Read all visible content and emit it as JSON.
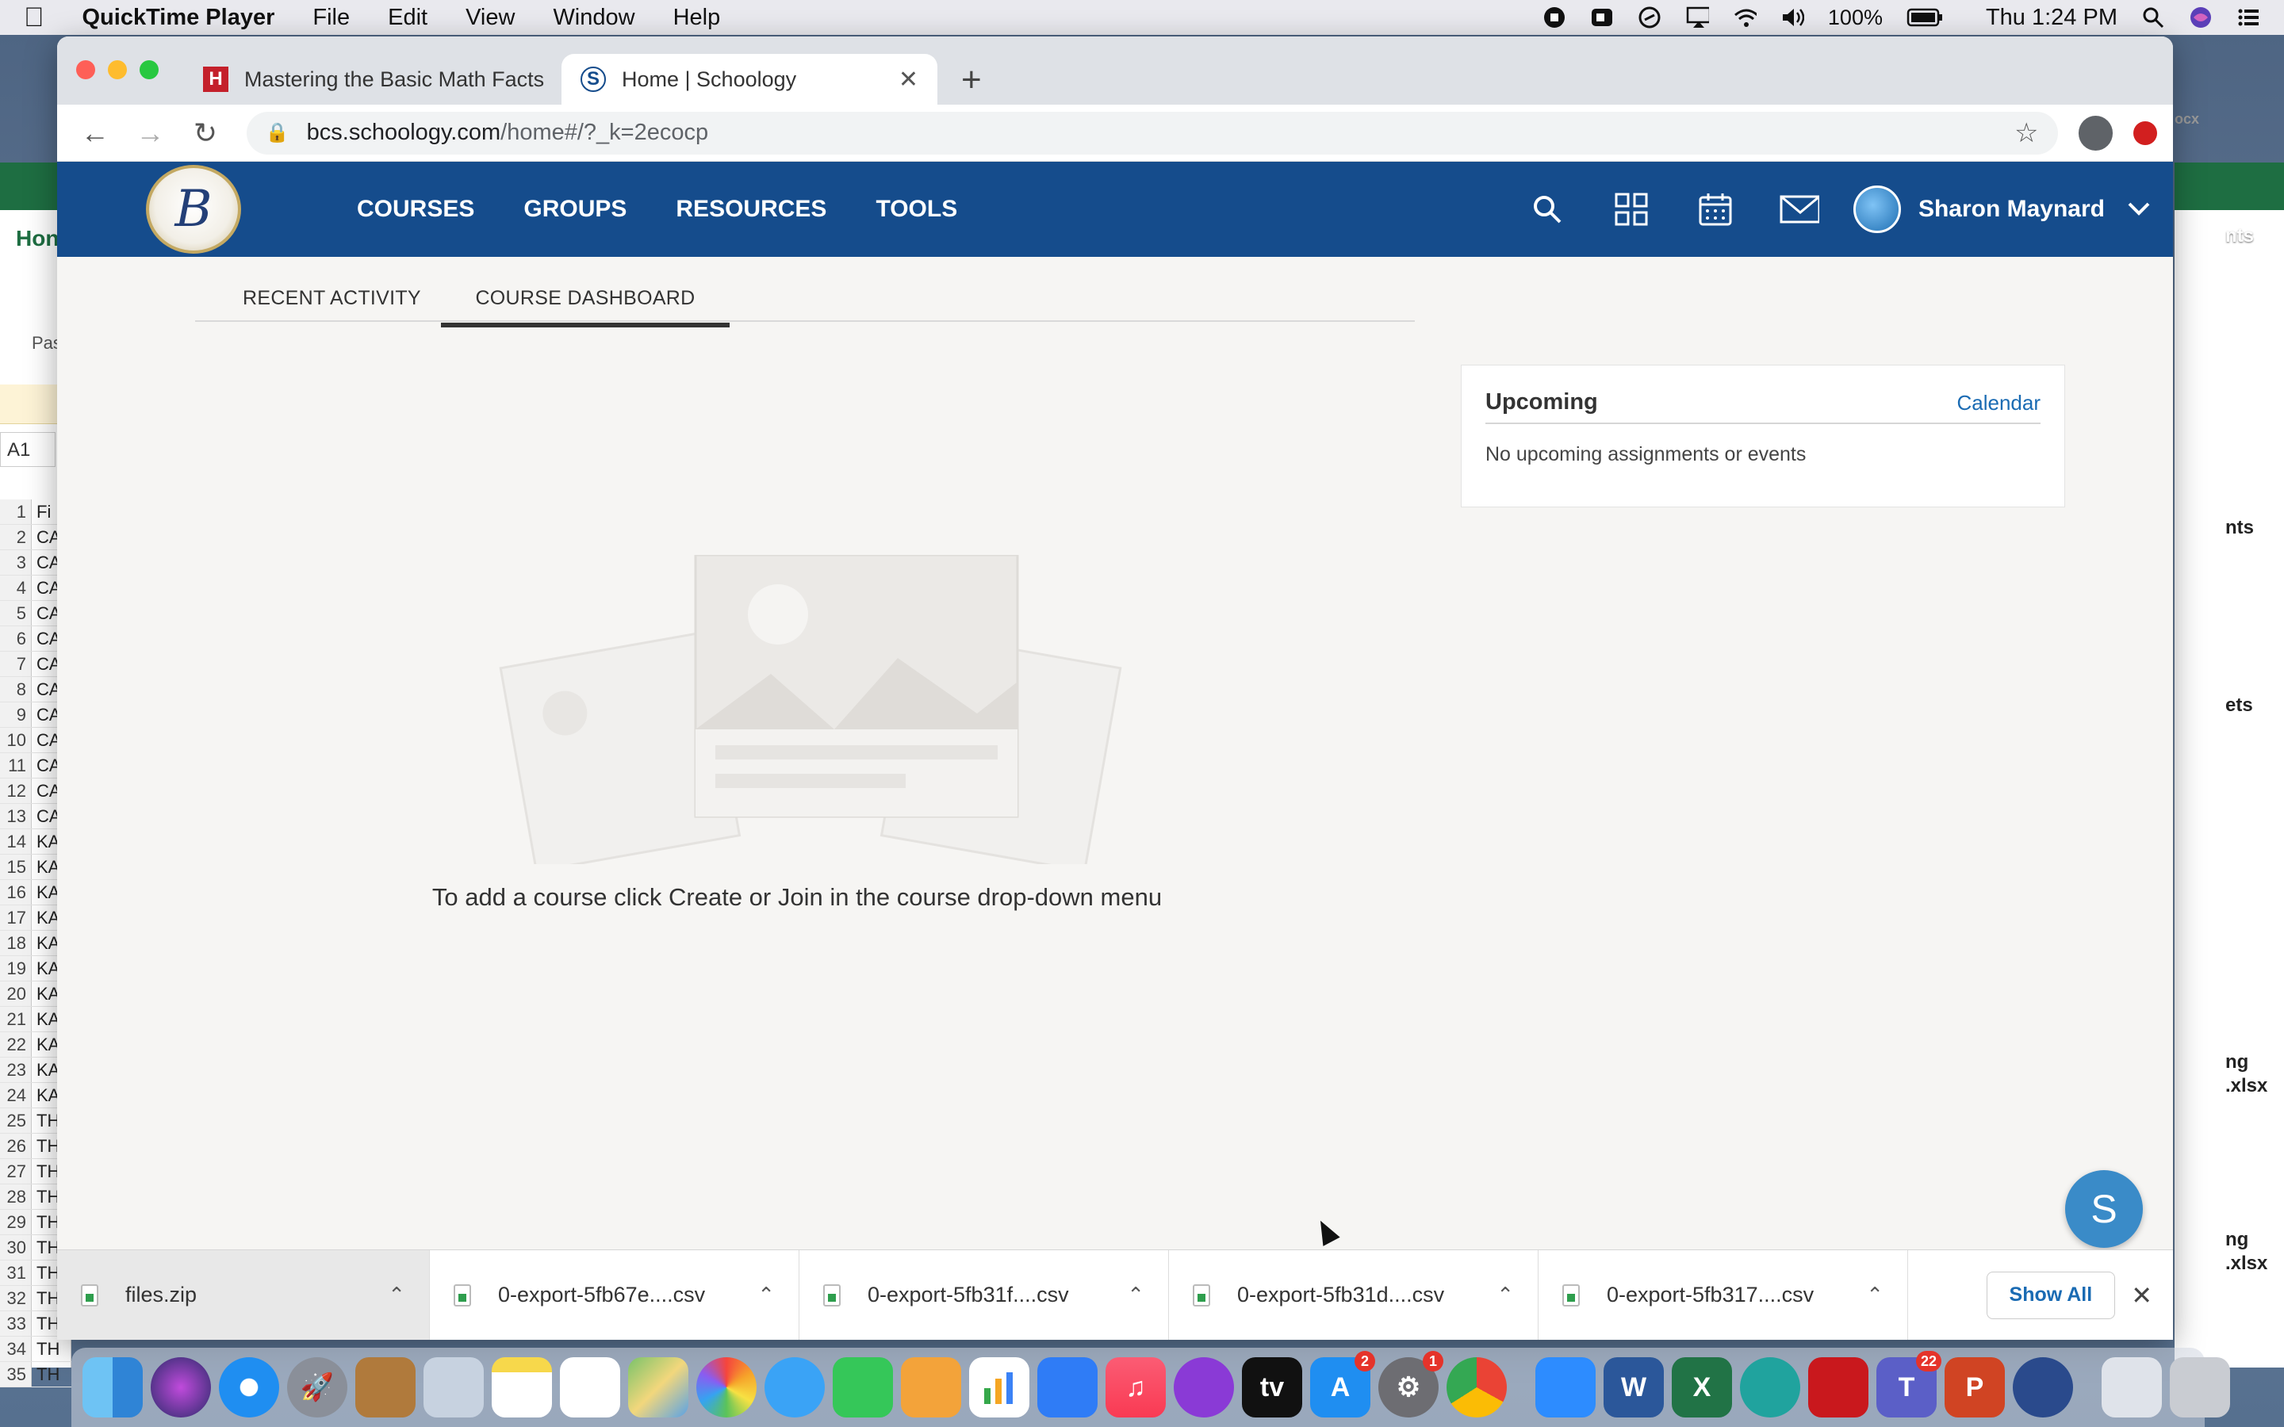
{
  "menubar": {
    "app_name": "QuickTime Player",
    "items": [
      "File",
      "Edit",
      "View",
      "Window",
      "Help"
    ],
    "battery": "100%",
    "clock": "Thu 1:24 PM"
  },
  "browser": {
    "tabs": [
      {
        "title": "Mastering the Basic Math Facts",
        "favicon": "H"
      },
      {
        "title": "Home | Schoology",
        "favicon": "S"
      }
    ],
    "url_domain": "bcs.schoology.com",
    "url_path": "/home#/?_k=2ecocp"
  },
  "schoology": {
    "nav": [
      "COURSES",
      "GROUPS",
      "RESOURCES",
      "TOOLS"
    ],
    "user_name": "Sharon Maynard",
    "subtabs": [
      "RECENT ACTIVITY",
      "COURSE DASHBOARD"
    ],
    "empty_message": "To add a course click Create or Join in the course drop-down menu",
    "upcoming": {
      "title": "Upcoming",
      "calendar_link": "Calendar",
      "empty": "No upcoming assignments or events"
    },
    "chat_label": "S"
  },
  "downloads": {
    "files": [
      "files.zip",
      "0-export-5fb67e....csv",
      "0-export-5fb31f....csv",
      "0-export-5fb31d....csv",
      "0-export-5fb317....csv"
    ],
    "show_all": "Show All"
  },
  "excel_bg": {
    "cell_ref": "A1",
    "tab_label": "Hon",
    "paste_label": "Pas",
    "rows": [
      {
        "n": "1",
        "v": "Fi"
      },
      {
        "n": "2",
        "v": "CA"
      },
      {
        "n": "3",
        "v": "CA"
      },
      {
        "n": "4",
        "v": "CA"
      },
      {
        "n": "5",
        "v": "CA"
      },
      {
        "n": "6",
        "v": "CA"
      },
      {
        "n": "7",
        "v": "CA"
      },
      {
        "n": "8",
        "v": "CA"
      },
      {
        "n": "9",
        "v": "CA"
      },
      {
        "n": "10",
        "v": "CA"
      },
      {
        "n": "11",
        "v": "CA"
      },
      {
        "n": "12",
        "v": "CA"
      },
      {
        "n": "13",
        "v": "CA"
      },
      {
        "n": "14",
        "v": "KA"
      },
      {
        "n": "15",
        "v": "KA"
      },
      {
        "n": "16",
        "v": "KA"
      },
      {
        "n": "17",
        "v": "KA"
      },
      {
        "n": "18",
        "v": "KA"
      },
      {
        "n": "19",
        "v": "KA"
      },
      {
        "n": "20",
        "v": "KA"
      },
      {
        "n": "21",
        "v": "KA"
      },
      {
        "n": "22",
        "v": "KA"
      },
      {
        "n": "23",
        "v": "KA"
      },
      {
        "n": "24",
        "v": "KA"
      },
      {
        "n": "25",
        "v": "TH"
      },
      {
        "n": "26",
        "v": "TH"
      },
      {
        "n": "27",
        "v": "TH"
      },
      {
        "n": "28",
        "v": "TH"
      },
      {
        "n": "29",
        "v": "TH"
      },
      {
        "n": "30",
        "v": "TH"
      },
      {
        "n": "31",
        "v": "TH"
      },
      {
        "n": "32",
        "v": "TH"
      },
      {
        "n": "33",
        "v": "TH"
      },
      {
        "n": "34",
        "v": "TH"
      },
      {
        "n": "35",
        "v": "TH"
      }
    ]
  },
  "desktop_labels": [
    "ocx",
    "nts",
    "ets",
    "ng",
    ".xlsx",
    "ng",
    ".xlsx"
  ],
  "dock": {
    "badges": {
      "app_store": "2",
      "system_prefs": "1",
      "teams": "22"
    }
  },
  "colors": {
    "schoology_blue": "#154c8c",
    "link_blue": "#1a6bb3",
    "chat_blue": "#3a8bc8"
  }
}
